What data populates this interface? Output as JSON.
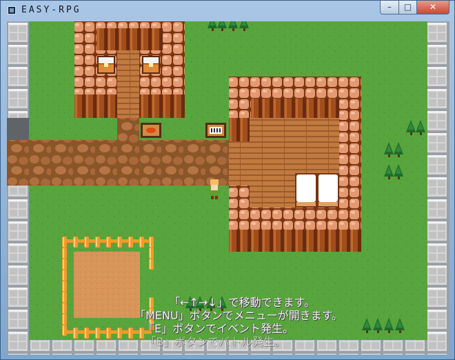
{
  "window": {
    "title": "EASY-RPG"
  },
  "titlebar_buttons": {
    "minimize": "–",
    "maximize": "□",
    "close": "✕"
  },
  "help": [
    "「←↑→↓」で移動できます。",
    "「MENU」ボタンでメニューが開きます。",
    "「E」ボタンでイベント発生。",
    "「B」ボタンでバトル発生。"
  ],
  "colors": {
    "grass": "#58a43d",
    "path": "#a0642f",
    "roof_brick": "#e19870",
    "wood": "#b8703c",
    "stone": "#c8c8c8",
    "fence": "#f39a2c"
  }
}
